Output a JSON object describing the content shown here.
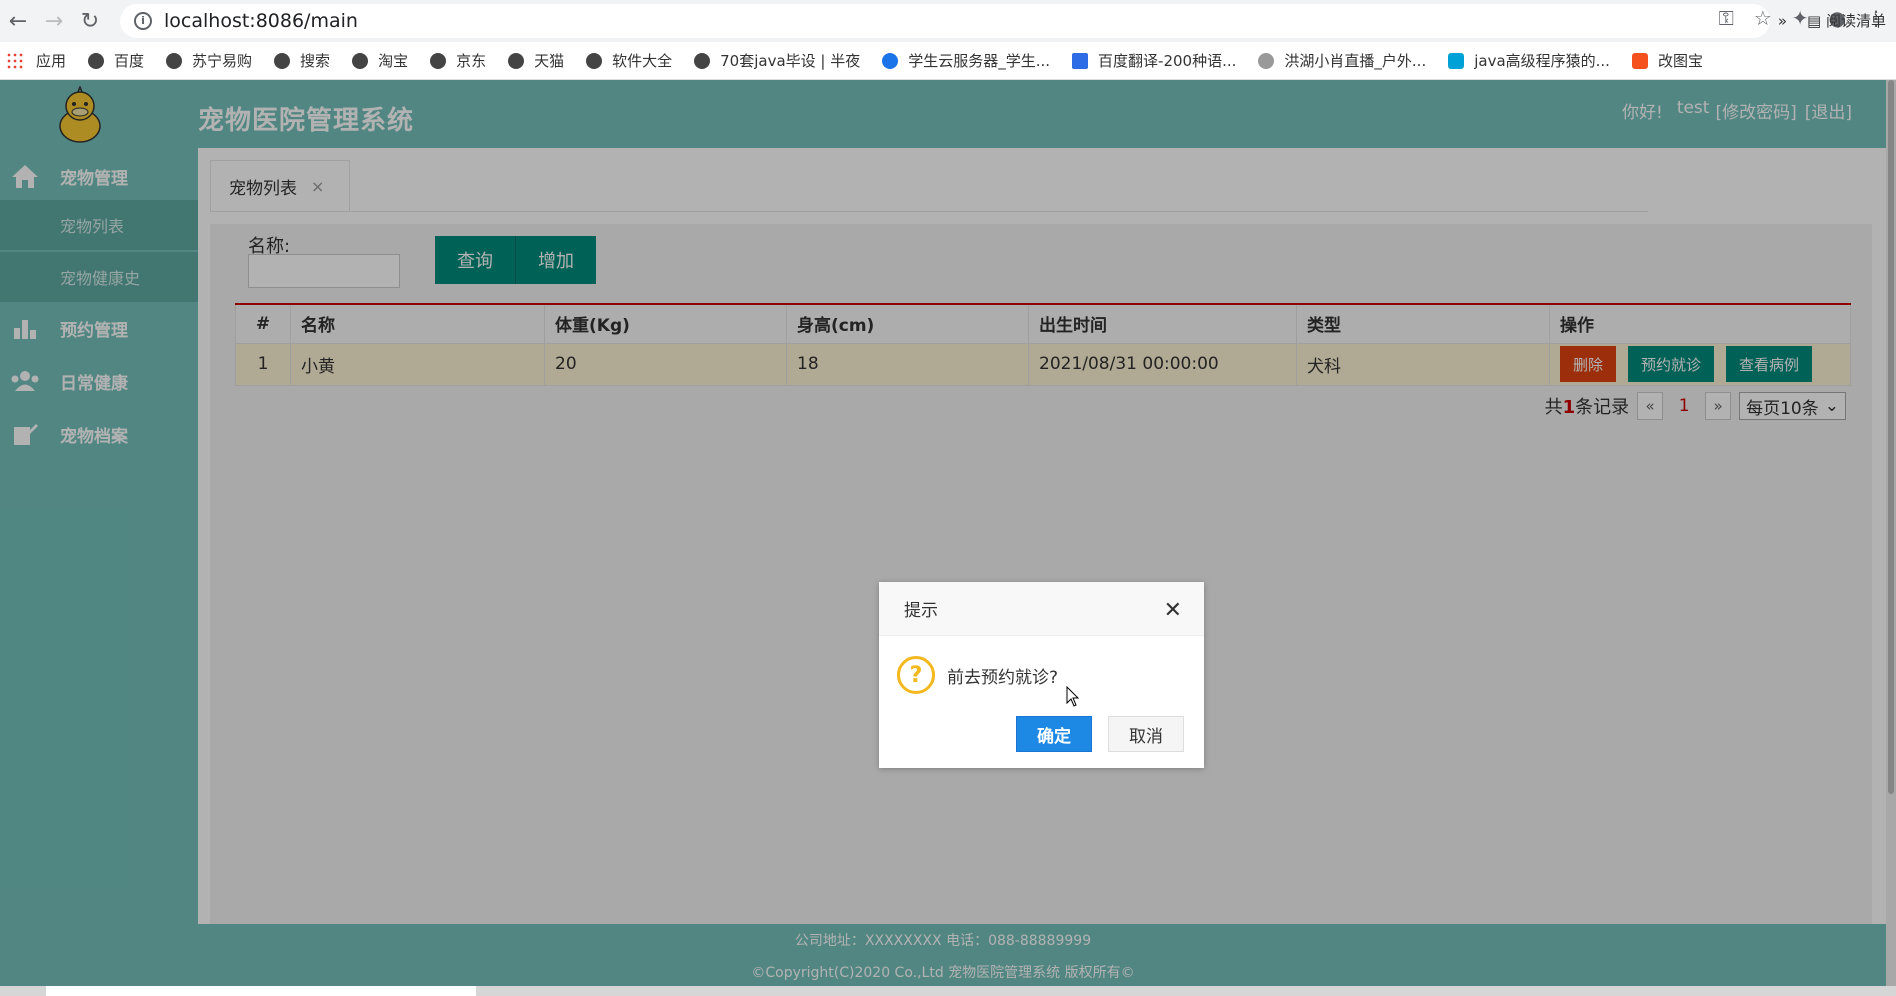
{
  "browser": {
    "url": "localhost:8086/main",
    "bookmarks": [
      "应用",
      "百度",
      "苏宁易购",
      "搜索",
      "淘宝",
      "京东",
      "天猫",
      "软件大全",
      "70套java毕设 | 半夜",
      "学生云服务器_学生...",
      "百度翻译-200种语...",
      "洪湖小肖直播_户外...",
      "java高级程序猿的...",
      "改图宝"
    ],
    "more": "»",
    "reading_list": "阅读清单"
  },
  "app": {
    "title": "宠物医院管理系统",
    "greeting": "你好!",
    "username": "test",
    "change_password": "[修改密码]",
    "logout": "[退出]"
  },
  "sidebar": {
    "pet_mgmt": "宠物管理",
    "pet_list": "宠物列表",
    "pet_health_history": "宠物健康史",
    "appointment_mgmt": "预约管理",
    "daily_health": "日常健康",
    "pet_archive": "宠物档案"
  },
  "tab": {
    "label": "宠物列表",
    "close": "×"
  },
  "search": {
    "label": "名称:",
    "value": "",
    "query_btn": "查询",
    "add_btn": "增加"
  },
  "table": {
    "headers": [
      "#",
      "名称",
      "体重(Kg)",
      "身高(cm)",
      "出生时间",
      "类型",
      "操作"
    ],
    "rows": [
      {
        "idx": "1",
        "name": "小黄",
        "weight": "20",
        "height": "18",
        "birth": "2021/08/31 00:00:00",
        "type": "犬科"
      }
    ],
    "actions": {
      "delete": "删除",
      "book": "预约就诊",
      "view": "查看病例"
    }
  },
  "pager": {
    "prefix": "共",
    "count": "1",
    "suffix": "条记录",
    "prev": "«",
    "current": "1",
    "next": "»",
    "page_size": "每页10条"
  },
  "footer": {
    "line1": "公司地址：XXXXXXXX 电话：088-88889999",
    "line2": "©Copyright(C)2020 Co.,Ltd 宠物医院管理系统 版权所有©"
  },
  "dialog": {
    "title": "提示",
    "message": "前去预约就诊?",
    "ok": "确定",
    "cancel": "取消"
  },
  "colors": {
    "teal": "#74c1ba",
    "button_teal": "#008b7c",
    "danger": "#e04312",
    "primary": "#1e88e5",
    "warning_icon": "#f3b81d"
  }
}
